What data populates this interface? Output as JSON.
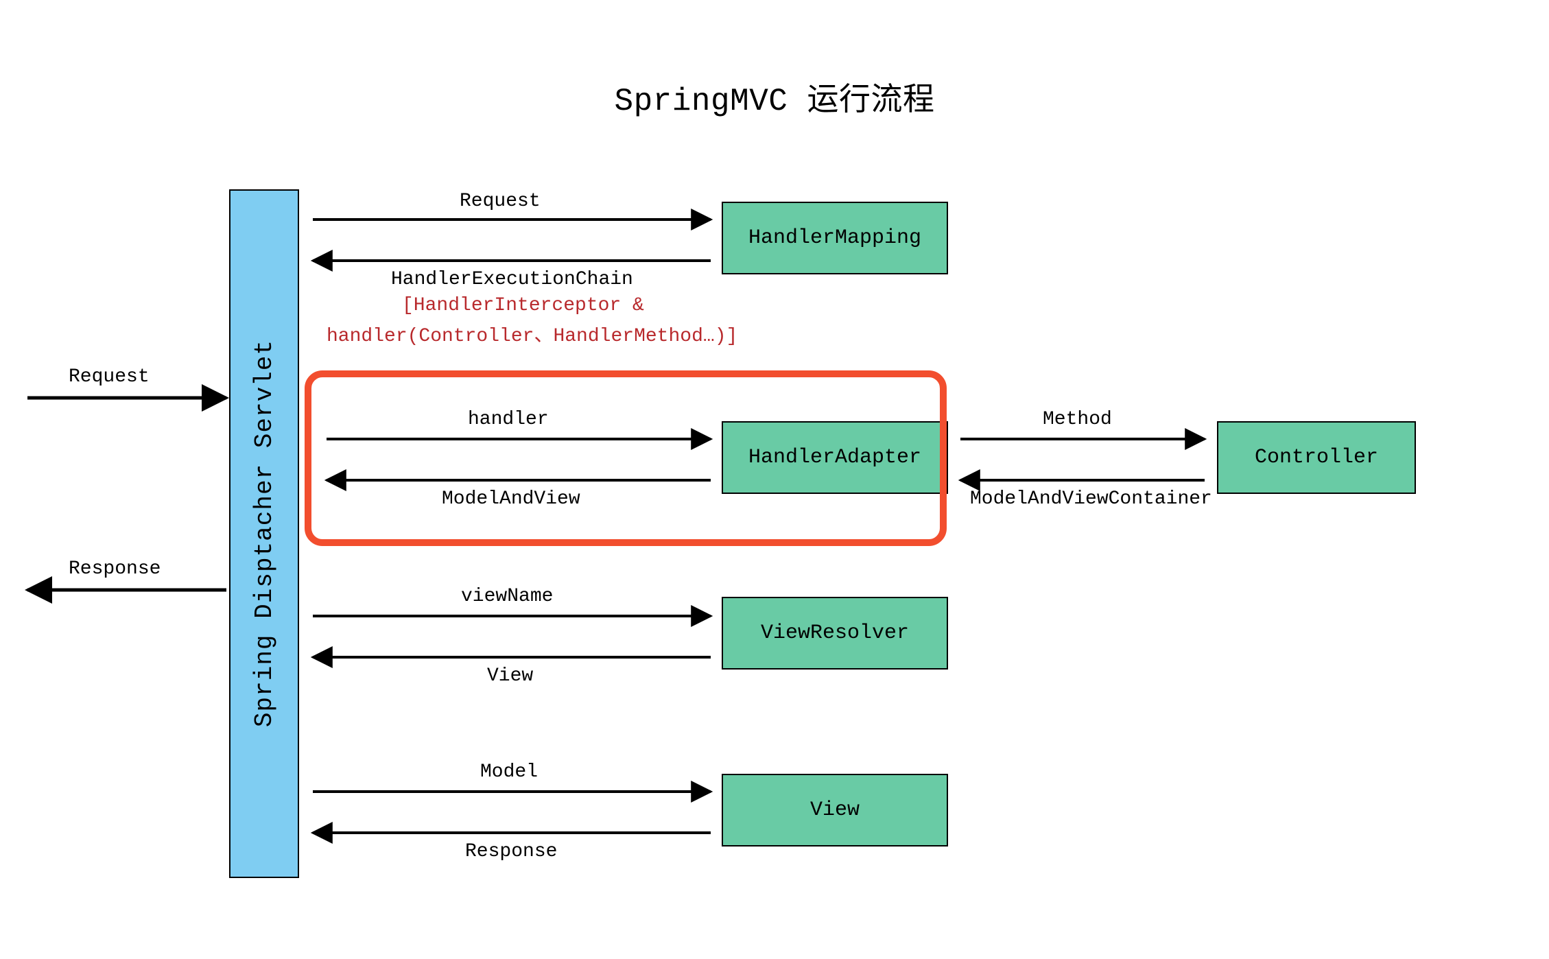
{
  "title": "SpringMVC 运行流程",
  "dispatcher": "Spring Disptacher Servlet",
  "io": {
    "request": "Request",
    "response": "Response"
  },
  "boxes": {
    "handlerMapping": "HandlerMapping",
    "handlerAdapter": "HandlerAdapter",
    "controller": "Controller",
    "viewResolver": "ViewResolver",
    "view": "View"
  },
  "labels": {
    "a1_top": "Request",
    "a1_bot": "HandlerExecutionChain",
    "a1_red1": "[HandlerInterceptor &",
    "a1_red2": "handler(Controller、HandlerMethod…)]",
    "a2_top": "handler",
    "a2_bot": "ModelAndView",
    "a2b_top": "Method",
    "a2b_bot": "ModelAndViewContainer",
    "a3_top": "viewName",
    "a3_bot": "View",
    "a4_top": "Model",
    "a4_bot": "Response"
  }
}
